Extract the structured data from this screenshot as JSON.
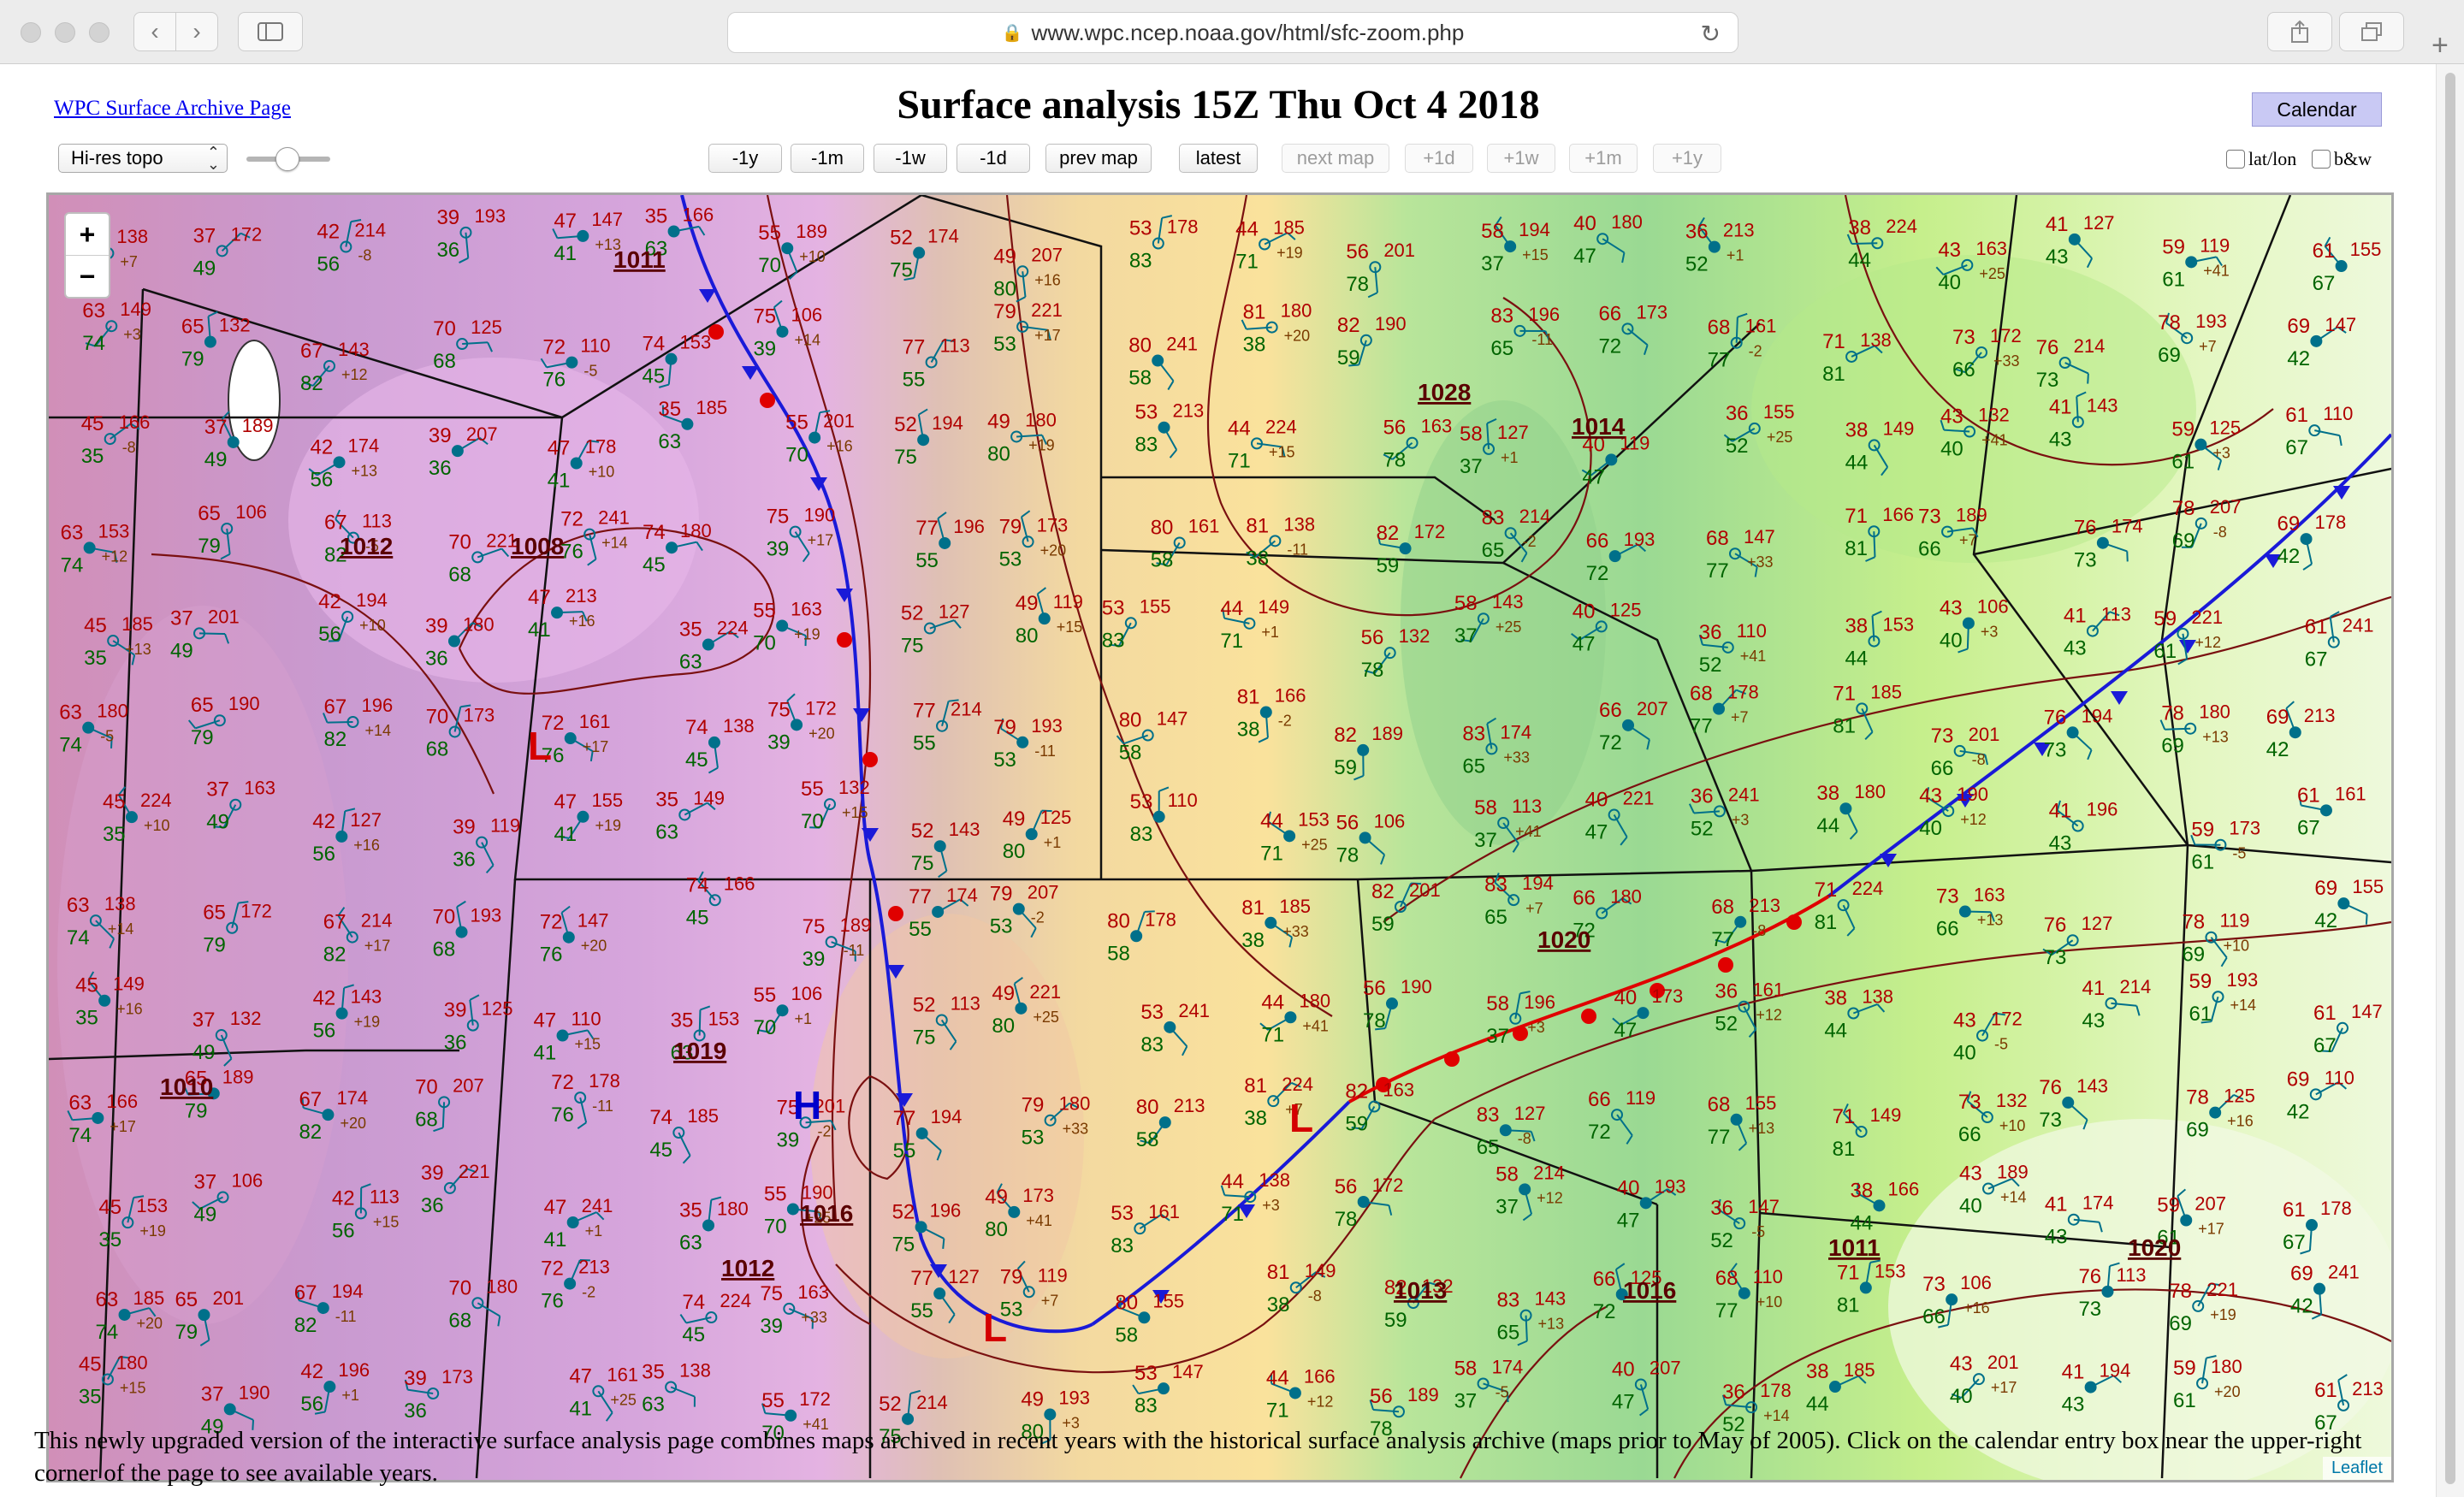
{
  "browser": {
    "url": "www.wpc.ncep.noaa.gov/html/sfc-zoom.php",
    "back_icon": "chevron-left-icon",
    "forward_icon": "chevron-right-icon",
    "sidebar_icon": "sidebar-icon",
    "share_icon": "share-icon",
    "tabs_icon": "tabs-icon",
    "new_tab_icon": "plus-icon"
  },
  "header": {
    "archive_link": "WPC Surface Archive Page",
    "title": "Surface analysis 15Z Thu Oct 4 2018",
    "calendar_button": "Calendar"
  },
  "toolbar": {
    "layer_select": "Hi-res topo",
    "buttons": [
      {
        "label": "-1y",
        "enabled": true
      },
      {
        "label": "-1m",
        "enabled": true
      },
      {
        "label": "-1w",
        "enabled": true
      },
      {
        "label": "-1d",
        "enabled": true
      },
      {
        "label": "prev map",
        "enabled": true
      },
      {
        "label": "latest",
        "enabled": true
      },
      {
        "label": "next map",
        "enabled": false
      },
      {
        "label": "+1d",
        "enabled": false
      },
      {
        "label": "+1w",
        "enabled": false
      },
      {
        "label": "+1m",
        "enabled": false
      },
      {
        "label": "+1y",
        "enabled": false
      }
    ],
    "latlon_label": "lat/lon",
    "bw_label": "b&w"
  },
  "map": {
    "zoom_in": "+",
    "zoom_out": "−",
    "attribution": "Leaflet",
    "pressure_labels": [
      "1011",
      "1008",
      "1012",
      "1019",
      "1010",
      "1016",
      "1012",
      "1013",
      "1020",
      "1016",
      "1020",
      "1028",
      "1014",
      "1011"
    ],
    "centers": [
      {
        "type": "L",
        "color": "#d40000"
      },
      {
        "type": "H",
        "color": "#0000cc"
      },
      {
        "type": "L",
        "color": "#d40000"
      },
      {
        "type": "L",
        "color": "#d40000"
      }
    ],
    "station_values": [
      "45",
      "37",
      "42",
      "39",
      "47",
      "35",
      "55",
      "52",
      "49",
      "53",
      "44",
      "56",
      "58",
      "40",
      "36",
      "38",
      "43",
      "41",
      "59",
      "61",
      "63",
      "65",
      "67",
      "70",
      "72",
      "74",
      "75",
      "77",
      "79",
      "80",
      "81",
      "82",
      "83",
      "66",
      "68",
      "71",
      "73",
      "76",
      "78",
      "69"
    ],
    "pressure_codes": [
      "138",
      "172",
      "214",
      "193",
      "147",
      "166",
      "189",
      "174",
      "207",
      "178",
      "185",
      "201",
      "194",
      "180",
      "213",
      "224",
      "163",
      "127",
      "119",
      "155",
      "149",
      "132",
      "143",
      "125",
      "110",
      "153",
      "106",
      "113",
      "221",
      "241",
      "180",
      "190",
      "196",
      "173",
      "161"
    ],
    "tendencies": [
      "+7",
      "+3",
      "-8",
      "+12",
      "+13",
      "-5",
      "+10",
      "+14",
      "+16",
      "+17",
      "+19",
      "+20",
      "+15",
      "-11",
      "+1",
      "-2",
      "+25",
      "+33",
      "+41"
    ]
  },
  "footer": {
    "text": "This newly upgraded version of the interactive surface analysis page combines maps archived in recent years with the historical surface analysis archive (maps prior to May of 2005). Click on the calendar entry box near the upper-right corner of the page to see available years."
  }
}
